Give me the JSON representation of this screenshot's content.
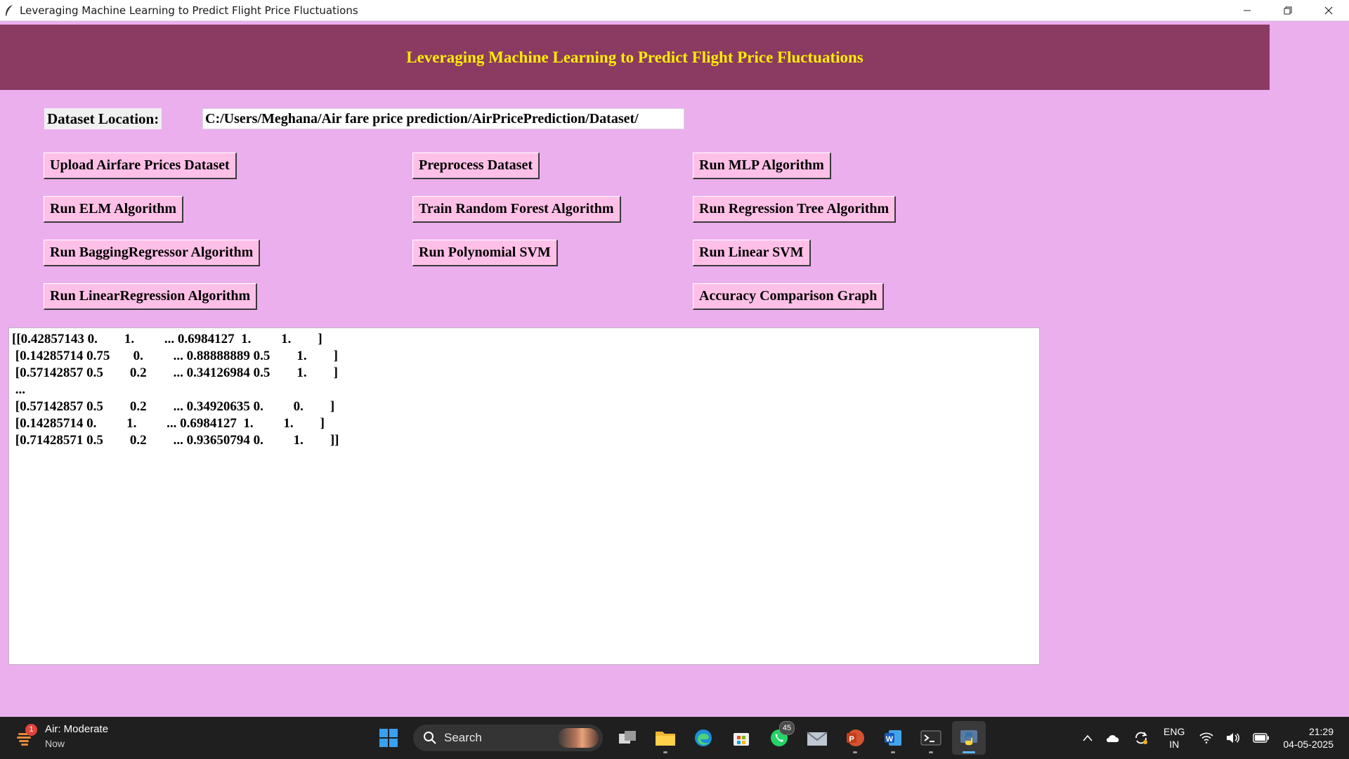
{
  "window": {
    "title": "Leveraging Machine Learning to Predict Flight Price Fluctuations",
    "controls": [
      "minimize-icon",
      "restore-icon",
      "close-icon"
    ]
  },
  "banner": {
    "title": "Leveraging Machine Learning to Predict Flight Price Fluctuations"
  },
  "dataset": {
    "label": "Dataset Location:",
    "path": "C:/Users/Meghana/Air fare price prediction/AirPricePrediction/Dataset/"
  },
  "buttons": {
    "upload": "Upload Airfare Prices Dataset",
    "preprocess": "Preprocess Dataset",
    "mlp": "Run MLP Algorithm",
    "elm": "Run ELM Algorithm",
    "random_forest": "Train Random Forest Algorithm",
    "regression_tree": "Run Regression Tree Algorithm",
    "bagging": "Run BaggingRegressor Algorithm",
    "poly_svm": "Run Polynomial SVM",
    "linear_svm": "Run Linear SVM",
    "linear_regression": "Run LinearRegression Algorithm",
    "accuracy_graph": "Accuracy Comparison Graph"
  },
  "output": {
    "lines": [
      "[[0.42857143 0.        1.         ... 0.6984127  1.         1.        ]",
      " [0.14285714 0.75       0.         ... 0.88888889 0.5        1.        ]",
      " [0.57142857 0.5        0.2        ... 0.34126984 0.5        1.        ]",
      " ...",
      " [0.57142857 0.5        0.2        ... 0.34920635 0.         0.        ]",
      " [0.14285714 0.         1.         ... 0.6984127  1.         1.        ]",
      " [0.71428571 0.5        0.2        ... 0.93650794 0.         1.        ]]"
    ]
  },
  "taskbar": {
    "weather": {
      "badge": "1",
      "title": "Air: Moderate",
      "subtitle": "Now"
    },
    "search": {
      "label": "Search"
    },
    "whatsapp_badge": "45",
    "language": {
      "line1": "ENG",
      "line2": "IN"
    },
    "clock": {
      "time": "21:29",
      "date": "04-05-2025"
    }
  },
  "colors": {
    "background": "#ecafee",
    "banner": "#8b3a62",
    "banner_text": "#ffee00",
    "button": "#ffc0e8"
  }
}
